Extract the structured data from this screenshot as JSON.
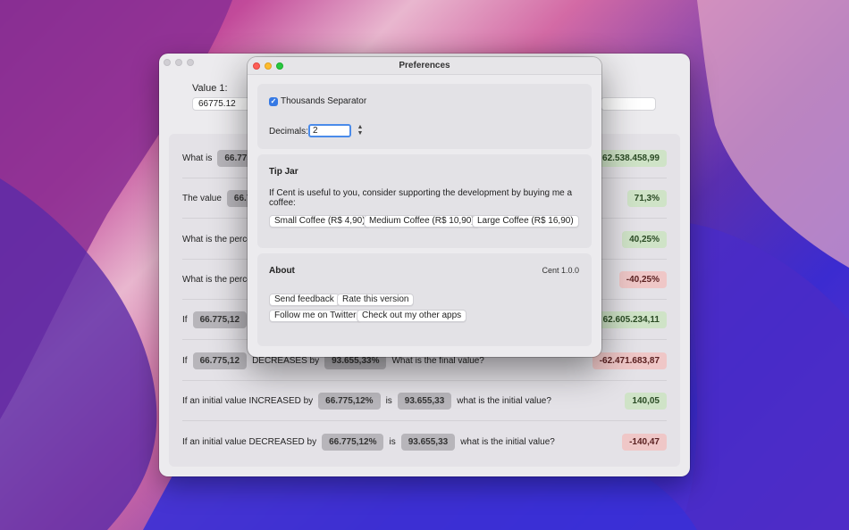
{
  "main": {
    "value1_label": "Value 1:",
    "value1_input": "66775.12",
    "rows": [
      {
        "prefix": "What is",
        "chip1": "66.775",
        "result": "62.538.458,99",
        "tone": "pos"
      },
      {
        "prefix": "The value",
        "chip1": "66.7",
        "result": "71,3%",
        "tone": "pos"
      },
      {
        "prefix": "What is the percer",
        "result": "40,25%",
        "tone": "pos"
      },
      {
        "prefix": "What is the percer",
        "result": "-40,25%",
        "tone": "neg"
      },
      {
        "prefix": "If",
        "chip1": "66.775,12",
        "result": "62.605.234,11",
        "tone": "pos"
      },
      {
        "prefix": "If",
        "chip1": "66.775,12",
        "mid": "DECREASES by",
        "chip2": "93.655,33%",
        "suffix": "What is the final value?",
        "result": "-62.471.683,87",
        "tone": "neg"
      },
      {
        "prefix": "If an initial value INCREASED by",
        "chip1": "66.775,12%",
        "mid": "is",
        "chip2": "93.655,33",
        "suffix": "what is the initial value?",
        "result": "140,05",
        "tone": "pos"
      },
      {
        "prefix": "If an initial value DECREASED by",
        "chip1": "66.775,12%",
        "mid": "is",
        "chip2": "93.655,33",
        "suffix": "what is the initial value?",
        "result": "-140,47",
        "tone": "neg"
      }
    ]
  },
  "prefs": {
    "title": "Preferences",
    "thousands_label": "Thousands Separator",
    "decimals_label": "Decimals:",
    "decimals_value": "2",
    "tip_title": "Tip Jar",
    "tip_text": "If Cent is useful to you, consider supporting the development by buying me a coffee:",
    "tip_buttons": [
      "Small Coffee (R$ 4,90)",
      "Medium Coffee (R$ 10,90)",
      "Large Coffee (R$ 16,90)"
    ],
    "about_title": "About",
    "version": "Cent 1.0.0",
    "about_buttons": [
      "Send feedback",
      "Rate this version",
      "Follow me on Twitter",
      "Check out my other apps"
    ]
  },
  "colors": {
    "accent": "#3679e4",
    "positive_bg": "#cfe3c7",
    "negative_bg": "#efc7c7"
  }
}
